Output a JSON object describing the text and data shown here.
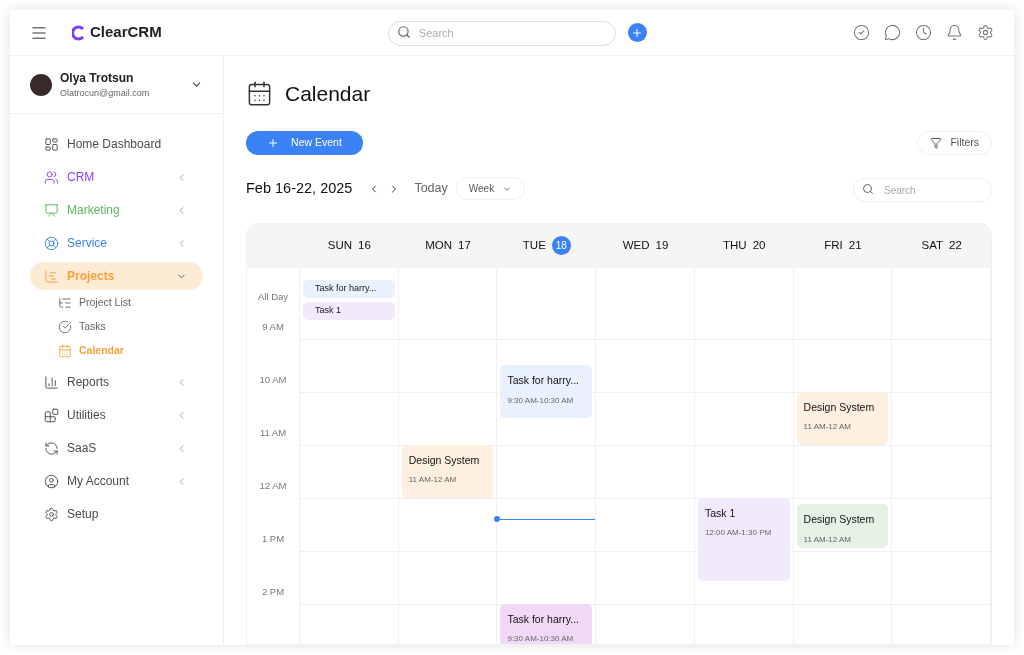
{
  "header": {
    "logo": "ClearCRM",
    "search": {
      "placeholder": "Search"
    }
  },
  "user": {
    "name": "Olya Trotsun",
    "email": "Olatrocun@gmail.com"
  },
  "sidebar": {
    "items": [
      {
        "label": "Home Dashboard",
        "kind": "link",
        "selected": false,
        "color": "#4b4b4b"
      },
      {
        "label": "CRM",
        "kind": "group",
        "expanded": false,
        "selected": false,
        "color": "#8b3dff"
      },
      {
        "label": "Marketing",
        "kind": "group",
        "expanded": false,
        "selected": false,
        "color": "#5cb85c"
      },
      {
        "label": "Service",
        "kind": "group",
        "expanded": false,
        "selected": false,
        "color": "#3b82f6"
      },
      {
        "label": "Projects",
        "kind": "group",
        "expanded": true,
        "selected": true,
        "color": "#f7a13c",
        "children": [
          {
            "label": "Project List",
            "selected": false
          },
          {
            "label": "Tasks",
            "selected": false
          },
          {
            "label": "Calendar",
            "selected": true
          }
        ]
      },
      {
        "label": "Reports",
        "kind": "group",
        "expanded": false,
        "selected": false,
        "color": "#4b4b4b"
      },
      {
        "label": "Utilities",
        "kind": "group",
        "expanded": false,
        "selected": false,
        "color": "#4b4b4b"
      },
      {
        "label": "SaaS",
        "kind": "group",
        "expanded": false,
        "selected": false,
        "color": "#4b4b4b"
      },
      {
        "label": "My Account",
        "kind": "group",
        "expanded": false,
        "selected": false,
        "color": "#4b4b4b"
      },
      {
        "label": "Setup",
        "kind": "link",
        "selected": false,
        "color": "#4b4b4b"
      }
    ]
  },
  "page": {
    "title": "Calendar",
    "new_event": "New Event",
    "filters": "Filters",
    "range": "Feb 16-22, 2025",
    "today": "Today",
    "view": "Week",
    "search": {
      "placeholder": "Search"
    }
  },
  "calendar": {
    "all_day_label": "All Day",
    "hours": [
      "9 AM",
      "10 AM",
      "11 AM",
      "12 AM",
      "1 PM",
      "2 PM"
    ],
    "days": [
      {
        "name": "SUN",
        "date": "16",
        "selected": false,
        "all_day": [
          {
            "title": "Task for harry...",
            "color": "#e9f1fd"
          },
          {
            "title": "Task 1",
            "color": "#f1eafd"
          }
        ]
      },
      {
        "name": "MON",
        "date": "17",
        "selected": false,
        "events": [
          {
            "title": "Design System",
            "time": "11 AM-12 AM",
            "color": "#fdf0e1"
          }
        ]
      },
      {
        "name": "TUE",
        "date": "18",
        "selected": true,
        "events": [
          {
            "title": "Task for harry...",
            "time": "9:30 AM-10:30 AM",
            "color": "#e9f1fd"
          },
          {
            "title": "Task for harry...",
            "time": "9:30 AM-10:30 AM",
            "color": "#efd9f6"
          }
        ]
      },
      {
        "name": "WED",
        "date": "19",
        "selected": false
      },
      {
        "name": "THU",
        "date": "20",
        "selected": false,
        "events": [
          {
            "title": "Task 1",
            "time": "12:00 AM-1:30 PM",
            "color": "#f1eafd"
          }
        ]
      },
      {
        "name": "FRI",
        "date": "21",
        "selected": false,
        "events": [
          {
            "title": "Design System",
            "time": "11 AM-12 AM",
            "color": "#fdf0e1"
          },
          {
            "title": "Design System",
            "time": "11 AM-12 AM",
            "color": "#e6f1e5"
          }
        ]
      },
      {
        "name": "SAT",
        "date": "22",
        "selected": false
      }
    ]
  }
}
